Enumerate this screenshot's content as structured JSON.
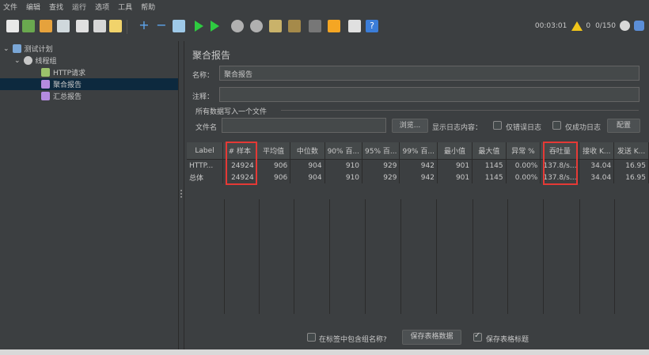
{
  "menu": [
    "文件",
    "编辑",
    "查找",
    "运行",
    "选项",
    "工具",
    "帮助"
  ],
  "toolbar": {
    "timer": "00:03:01",
    "warnings": "0",
    "threads": "0/150"
  },
  "tree": {
    "plan": "测试计划",
    "group": "线程组",
    "http": "HTTP请求",
    "aggregate": "聚合报告",
    "summary": "汇总报告"
  },
  "panel": {
    "title": "聚合报告",
    "name_label": "名称：",
    "name_value": "聚合报告",
    "comment_label": "注释：",
    "comment_value": "",
    "group_title": "所有数据写入一个文件",
    "file_label": "文件名",
    "file_value": "",
    "browse_button": "浏览...",
    "log_label": "显示日志内容：",
    "errors_only": "仅错误日志",
    "success_only": "仅成功日志",
    "config_button": "配置"
  },
  "table": {
    "headers": [
      "Label",
      "# 样本",
      "平均值",
      "中位数",
      "90% 百...",
      "95% 百...",
      "99% 百...",
      "最小值",
      "最大值",
      "异常 %",
      "吞吐量",
      "接收 K...",
      "发送 K..."
    ],
    "rows": [
      [
        "HTTP...",
        "24924",
        "906",
        "904",
        "910",
        "929",
        "942",
        "901",
        "1145",
        "0.00%",
        "137.8/s...",
        "34.04",
        "16.95"
      ],
      [
        "总体",
        "24924",
        "906",
        "904",
        "910",
        "929",
        "942",
        "901",
        "1145",
        "0.00%",
        "137.8/s...",
        "34.04",
        "16.95"
      ]
    ]
  },
  "footer": {
    "include_group": "在标签中包含组名称?",
    "save_data": "保存表格数据",
    "save_header": "保存表格标题"
  },
  "colors": {
    "background": "#3c3f41",
    "highlight": "#e53935",
    "selection": "#0d293e"
  }
}
